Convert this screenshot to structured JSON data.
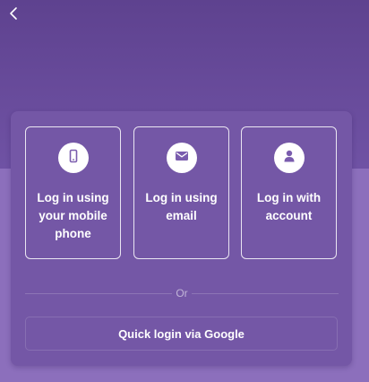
{
  "colors": {
    "header_band": "#5e428f",
    "page_background": "#8c6fbc",
    "card_background": "#7457a6",
    "icon_fill": "#7a5cae",
    "text": "#ffffff"
  },
  "nav": {
    "back_icon": "chevron-left-icon"
  },
  "login_options": [
    {
      "label": "Log in using your mobile phone",
      "icon": "mobile-phone-icon"
    },
    {
      "label": "Log in using email",
      "icon": "envelope-icon"
    },
    {
      "label": "Log in with account",
      "icon": "user-icon"
    }
  ],
  "divider": {
    "text": "Or"
  },
  "google_login": {
    "label": "Quick login via Google"
  }
}
